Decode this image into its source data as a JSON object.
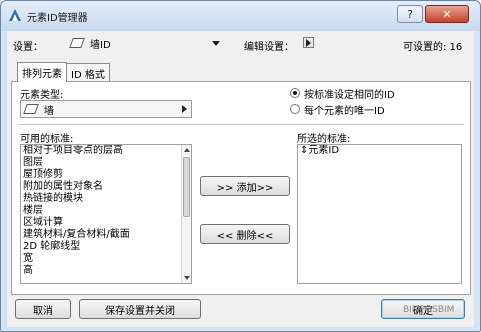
{
  "window": {
    "title": "元素ID管理器",
    "ghost_title": "​"
  },
  "header": {
    "settings_label": "设置：",
    "settings_value": "墙ID",
    "edit_settings_label": "编辑设置：",
    "settable_label": "可设置的: 16"
  },
  "tabs": [
    {
      "label": "排列元素",
      "active": true
    },
    {
      "label": "ID 格式",
      "active": false
    }
  ],
  "element_type": {
    "label": "元素类型:",
    "value": "墙"
  },
  "id_mode": {
    "options": [
      {
        "label": "按标准设定相同的ID",
        "selected": true
      },
      {
        "label": "每个元素的唯一ID",
        "selected": false
      }
    ]
  },
  "available": {
    "label": "可用的标准:",
    "items": [
      "相对于项目零点的层高",
      "图层",
      "屋顶修剪",
      "附加的属性对象名",
      "热链接的模块",
      "楼层",
      "区域计算",
      "建筑材料/复合材料/截面",
      "2D 轮廓线型",
      "宽",
      "高"
    ]
  },
  "selected": {
    "label": "所选的标准:",
    "items": [
      {
        "label": "元素ID",
        "prefix": "⇕"
      }
    ]
  },
  "actions": {
    "add_label": ">> 添加>>",
    "remove_label": "<< 删除<<"
  },
  "footer": {
    "cancel_label": "取消",
    "save_close_label": "保存设置并关闭",
    "ok_label": "确定",
    "watermark_text": "BIMPOSBIM"
  },
  "colors": {
    "window_frame": "#d6e3f1",
    "client_bg": "#f0f0f0",
    "close_button": "#c2422a"
  },
  "icons": [
    "app-icon",
    "help-icon",
    "close-icon",
    "wall-icon",
    "chevron-down-icon",
    "arrow-right-icon",
    "scroll-up-icon",
    "scroll-down-icon"
  ]
}
